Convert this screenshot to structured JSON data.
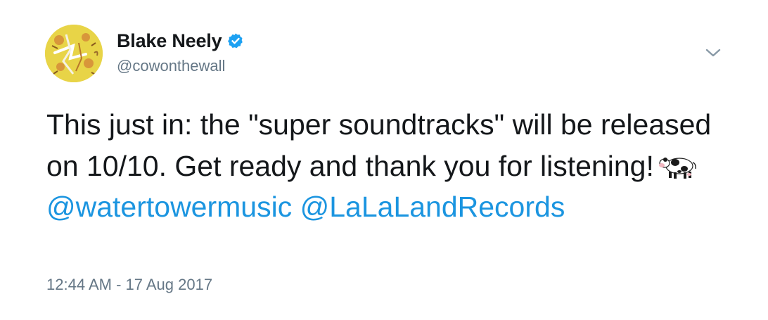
{
  "author": {
    "display_name": "Blake Neely",
    "handle": "@cowonthewall",
    "verified": true,
    "avatar_icon": "cartoon-avatar-icon"
  },
  "tweet": {
    "text_line_part1": "This just in: the \"super soundtracks\" will be released on 10/10. Get ready and thank you for listening!",
    "emoji_icon": "cow-emoji-icon",
    "mention_1": "@watertowermusic",
    "mention_2": "@LaLaLandRecords",
    "timestamp": "12:44 AM - 17 Aug 2017"
  },
  "menu": {
    "caret_icon": "chevron-down-icon"
  },
  "colors": {
    "link": "#1b95e0",
    "text": "#14171a",
    "secondary": "#657786",
    "verified": "#1da1f2"
  }
}
